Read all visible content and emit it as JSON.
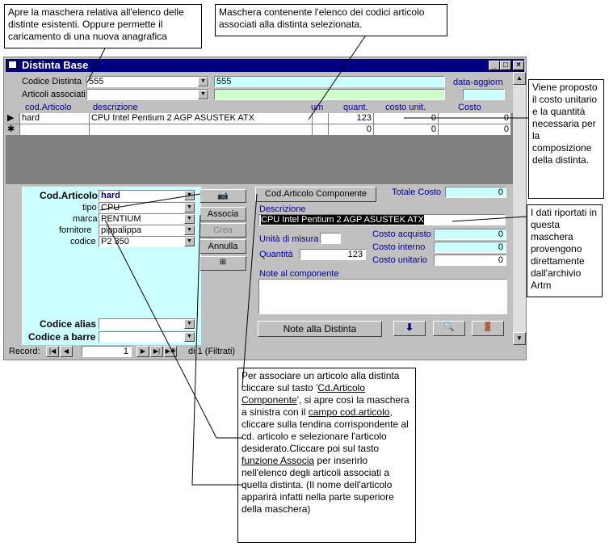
{
  "callouts": {
    "top_left": "Apre la maschera relativa all'elenco delle distinte esistenti. Oppure permette  il caricamento di una nuova anagrafica",
    "top_center": "Maschera contenente l'elenco dei codici articolo associati alla distinta selezionata.",
    "right_top": "Viene proposto il costo unitario e la quantità necessaria per la composizione della distinta.",
    "right_mid": "I dati riportati in questa maschera provengono direttamente dall'archivio Artm",
    "bottom_p1": "Per associare un articolo alla distinta cliccare sul tasto '",
    "bottom_u1": "Cd.Articolo Componente",
    "bottom_p2": "', si apre così la maschera a sinistra con il ",
    "bottom_u2": "campo cod.articolo",
    "bottom_p3": ", cliccare sulla tendina corrispondente al cd. articolo e selezionare l'articolo desiderato.Cliccare poi sul tasto ",
    "bottom_u3": "funzione  Associa",
    "bottom_p4": " per inserirlo nell'elenco degli articoli associati a quella distinta. (Il nome dell'articolo apparirà infatti nella parte superiore della maschera)"
  },
  "window": {
    "title": "Distinta Base",
    "codice_distinta_label": "Codice Distinta",
    "codice_distinta_value": "555",
    "codice_distinta_desc": "555",
    "articoli_associati_label": "Articoli associati",
    "data_aggiorn_label": "data-aggiorn",
    "grid": {
      "headers": [
        "cod.Articolo",
        "descrizione",
        "um",
        "quant.",
        "costo unit.",
        "Costo"
      ],
      "rows": [
        {
          "cod": "hard",
          "desc": "CPU Intel Pentium 2 AGP ASUSTEK ATX",
          "um": "",
          "quant": "123",
          "costo_unit": "0",
          "costo": "0"
        },
        {
          "cod": "",
          "desc": "",
          "um": "",
          "quant": "0",
          "costo_unit": "0",
          "costo": "0"
        }
      ]
    },
    "left_panel": {
      "cod_articolo_label": "Cod.Articolo",
      "cod_articolo_value": "hard",
      "tipo_label": "tipo",
      "tipo_value": "CPU",
      "marca_label": "marca",
      "marca_value": "PENTIUM",
      "fornitore_label": "fornitore",
      "fornitore_value": "pippalippa",
      "codice_label": "codice",
      "codice_value": "P2 350",
      "codice_alias_label": "Codice alias",
      "codice_barre_label": "Codice a barre"
    },
    "buttons": {
      "associa": "Associa",
      "crea": "Crea",
      "annulla": "Annulla",
      "cod_articolo_componente": "Cod.Articolo Componente",
      "note_distinta": "Note alla Distinta"
    },
    "right_panel": {
      "totale_costo_label": "Totale Costo",
      "totale_costo_value": "0",
      "descrizione_label": "Descrizione",
      "descrizione_value": "CPU Intel Pentium 2 AGP ASUSTEK ATX",
      "unita_misura_label": "Unità di misura",
      "unita_misura_value": "",
      "quantita_label": "Quantità",
      "quantita_value": "123",
      "costo_acquisto_label": "Costo acquisto",
      "costo_acquisto_value": "0",
      "costo_interno_label": "Costo interno",
      "costo_interno_value": "0",
      "costo_unitario_label": "Costo unitario",
      "costo_unitario_value": "0",
      "note_componente_label": "Note al componente"
    },
    "record_nav": {
      "label": "Record:",
      "current": "1",
      "suffix": "di 1 (Filtrati)"
    }
  },
  "colors": {
    "title_bar": "#000080",
    "panel_cyan": "#ccffff",
    "field_green": "#ccffcc",
    "window_gray": "#c0c0c0",
    "label_blue": "#0000a0"
  }
}
